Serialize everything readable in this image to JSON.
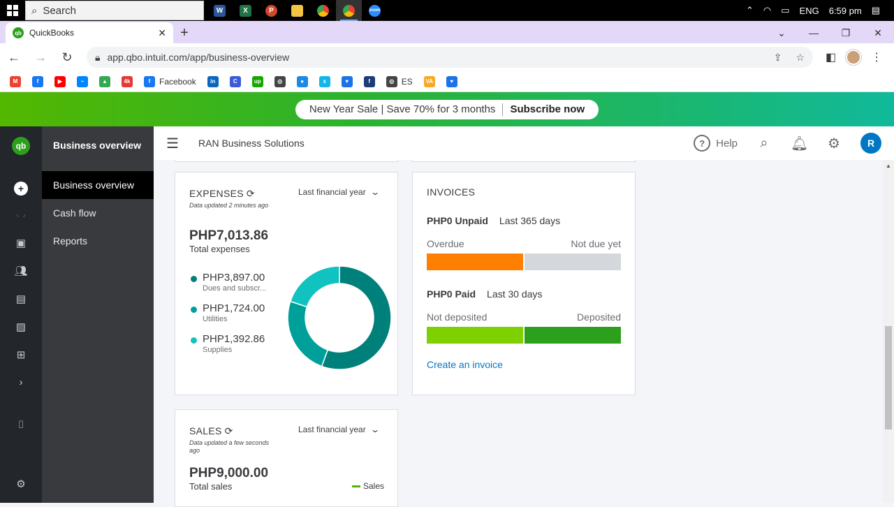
{
  "taskbar": {
    "search_placeholder": "Search",
    "apps": [
      "W",
      "X",
      "P",
      "folder",
      "chrome",
      "chrome",
      "zoom"
    ],
    "tray_lang": "ENG",
    "tray_time": "6:59 pm"
  },
  "browser": {
    "tab_title": "QuickBooks",
    "url": "app.qbo.intuit.com/app/business-overview",
    "bookmarks": [
      {
        "icon": "gmail-icon",
        "color": "#ea4335",
        "label": ""
      },
      {
        "icon": "facebook-icon",
        "color": "#1877f2",
        "label": ""
      },
      {
        "icon": "youtube-icon",
        "color": "#ff0000",
        "label": ""
      },
      {
        "icon": "messenger-icon",
        "color": "#0084ff",
        "label": ""
      },
      {
        "icon": "drive-icon",
        "color": "#34a853",
        "label": ""
      },
      {
        "icon": "4k-icon",
        "color": "#e53935",
        "label": ""
      },
      {
        "icon": "facebook-icon",
        "color": "#1877f2",
        "label": "Facebook"
      },
      {
        "icon": "linkedin-icon",
        "color": "#0a66c2",
        "label": ""
      },
      {
        "icon": "c-icon",
        "color": "#3b5bdb",
        "label": ""
      },
      {
        "icon": "upwork-icon",
        "color": "#14a800",
        "label": ""
      },
      {
        "icon": "globe-icon",
        "color": "#444",
        "label": ""
      },
      {
        "icon": "circle-icon",
        "color": "#1e88e5",
        "label": ""
      },
      {
        "icon": "xero-icon",
        "color": "#13b5ea",
        "label": ""
      },
      {
        "icon": "heart-icon",
        "color": "#1a73e8",
        "label": ""
      },
      {
        "icon": "f-icon",
        "color": "#1d3c78",
        "label": ""
      },
      {
        "icon": "globe-icon",
        "color": "#444",
        "label": "ES"
      },
      {
        "icon": "va-icon",
        "color": "#f9a825",
        "label": ""
      },
      {
        "icon": "heart-icon",
        "color": "#1a73e8",
        "label": ""
      }
    ]
  },
  "promo": {
    "text": "New Year Sale | Save 70% for 3 months",
    "cta": "Subscribe now"
  },
  "sidebar": {
    "title": "Business overview",
    "items": [
      {
        "label": "Business overview",
        "active": true
      },
      {
        "label": "Cash flow",
        "active": false
      },
      {
        "label": "Reports",
        "active": false
      }
    ]
  },
  "header": {
    "company": "RAN Business Solutions",
    "help": "Help",
    "user_initial": "R"
  },
  "expenses": {
    "title": "EXPENSES",
    "period": "Last financial year",
    "updated": "Data updated 2 minutes ago",
    "total": "PHP7,013.86",
    "total_label": "Total expenses",
    "items": [
      {
        "value": "PHP3,897.00",
        "label": "Dues and subscr...",
        "color": "#00807a"
      },
      {
        "value": "PHP1,724.00",
        "label": "Utilities",
        "color": "#00a09a"
      },
      {
        "value": "PHP1,392.86",
        "label": "Supplies",
        "color": "#10c2c0"
      }
    ]
  },
  "invoices": {
    "title": "INVOICES",
    "unpaid_amount": "PHP0 Unpaid",
    "unpaid_period": "Last 365 days",
    "overdue_label": "Overdue",
    "not_due_label": "Not due yet",
    "overdue_fraction": 0.5,
    "paid_amount": "PHP0 Paid",
    "paid_period": "Last 30 days",
    "not_deposited_label": "Not deposited",
    "deposited_label": "Deposited",
    "not_deposited_fraction": 0.5,
    "link": "Create an invoice",
    "colors": {
      "overdue": "#ff8000",
      "not_due": "#d4d7dc",
      "not_deposited": "#7fd000",
      "deposited": "#2ca01c"
    }
  },
  "sales": {
    "title": "SALES",
    "period": "Last financial year",
    "updated": "Data updated a few seconds ago",
    "total": "PHP9,000.00",
    "total_label": "Total sales",
    "legend": "Sales"
  }
}
